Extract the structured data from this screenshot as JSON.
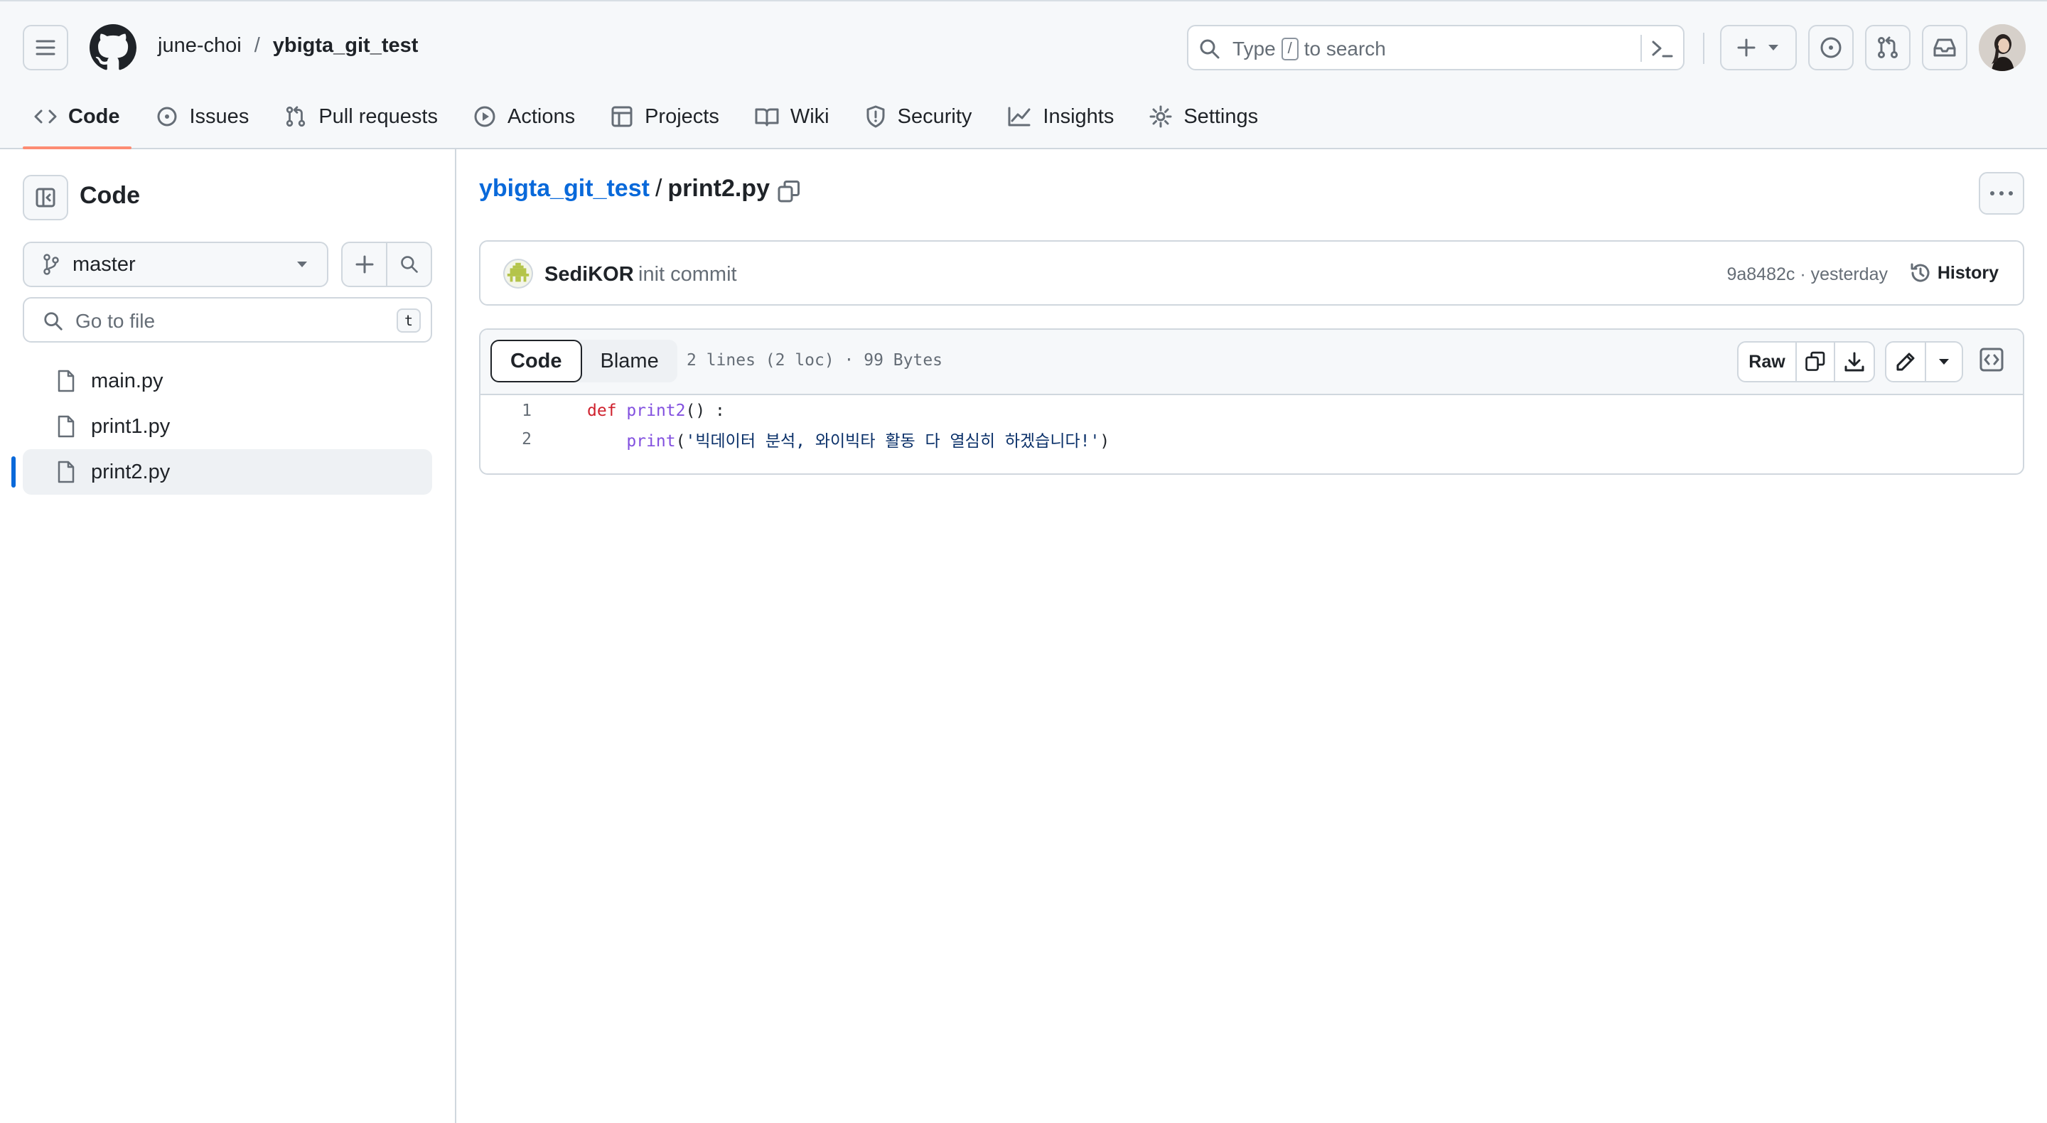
{
  "colors": {
    "accent_blue": "#0969da",
    "tab_underline": "#fd8c73",
    "keyword": "#cf222e",
    "function": "#8250df",
    "string": "#0a3069",
    "muted": "#656d76",
    "border": "#d0d7de"
  },
  "header": {
    "owner": "june-choi",
    "separator": "/",
    "repo": "ybigta_git_test",
    "search": {
      "type_label": "Type",
      "slash_key": "/",
      "to_search_label": "to search"
    },
    "icons": [
      "menu-icon",
      "github-logo-icon",
      "search-icon",
      "command-palette-icon",
      "plus-icon",
      "issue-opened-icon",
      "pull-request-icon",
      "inbox-icon",
      "avatar"
    ]
  },
  "tabs": [
    {
      "label": "Code",
      "icon": "code-icon",
      "active": true
    },
    {
      "label": "Issues",
      "icon": "issue-opened-icon"
    },
    {
      "label": "Pull requests",
      "icon": "git-pull-request-icon"
    },
    {
      "label": "Actions",
      "icon": "play-icon"
    },
    {
      "label": "Projects",
      "icon": "table-icon"
    },
    {
      "label": "Wiki",
      "icon": "book-icon"
    },
    {
      "label": "Security",
      "icon": "shield-icon"
    },
    {
      "label": "Insights",
      "icon": "graph-icon"
    },
    {
      "label": "Settings",
      "icon": "gear-icon"
    }
  ],
  "sidebar": {
    "title": "Code",
    "branch": "master",
    "goto_placeholder": "Go to file",
    "goto_key": "t",
    "files": [
      {
        "name": "main.py",
        "selected": false
      },
      {
        "name": "print1.py",
        "selected": false
      },
      {
        "name": "print2.py",
        "selected": true
      }
    ]
  },
  "main": {
    "breadcrumb_repo": "ybigta_git_test",
    "breadcrumb_sep": "/",
    "breadcrumb_file": "print2.py",
    "commit": {
      "author": "SediKOR",
      "message": "init commit",
      "meta": "9a8482c · yesterday",
      "history_label": "History"
    },
    "file": {
      "tab_code": "Code",
      "tab_blame": "Blame",
      "info": "2 lines (2 loc) · 99 Bytes",
      "raw_label": "Raw",
      "lines": [
        {
          "num": "1",
          "kw": "def",
          "fn": "print2",
          "rest": "() :"
        },
        {
          "num": "2",
          "indent": "    ",
          "fn": "print",
          "open": "(",
          "str": "'빅데이터 분석, 와이빅타 활동 다 열심히 하겠습니다!'",
          "close": ")"
        }
      ]
    }
  }
}
